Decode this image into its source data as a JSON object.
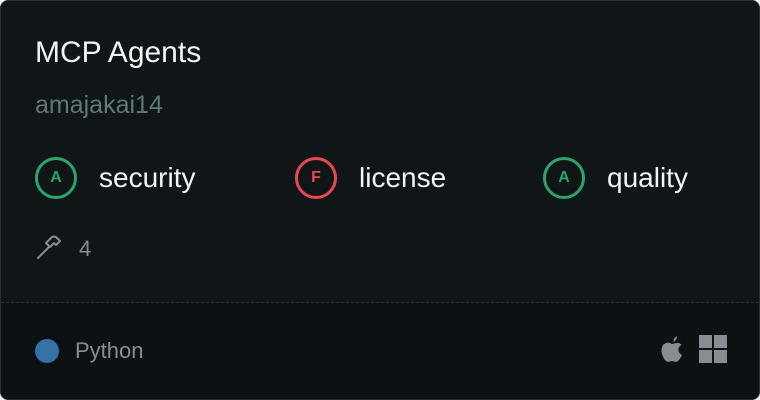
{
  "server": {
    "title": "MCP Agents",
    "author": "amajakai14"
  },
  "grades": [
    {
      "letter": "A",
      "label": "security",
      "color": "#2ea36a"
    },
    {
      "letter": "F",
      "label": "license",
      "color": "#e9474f"
    },
    {
      "letter": "A",
      "label": "quality",
      "color": "#2ea36a"
    }
  ],
  "tools": {
    "icon": "hammer-icon",
    "count": "4"
  },
  "language": {
    "name": "Python",
    "color": "#3572a5"
  },
  "platforms": [
    {
      "icon": "apple-icon"
    },
    {
      "icon": "windows-icon"
    }
  ]
}
